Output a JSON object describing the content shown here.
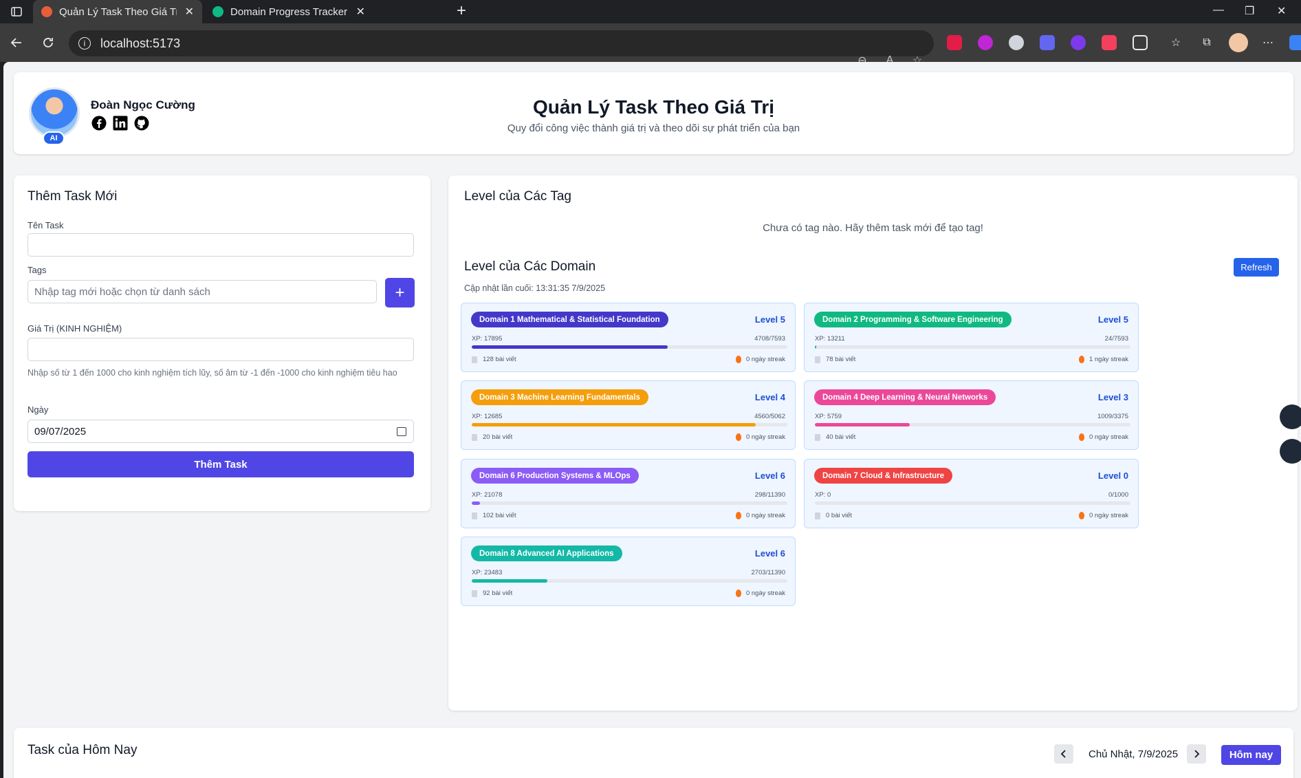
{
  "browser": {
    "tabs": [
      {
        "title": "Quản Lý Task Theo Giá Trị",
        "active": true
      },
      {
        "title": "Domain Progress Tracker API - Sw",
        "active": false
      }
    ],
    "url": "localhost:5173"
  },
  "header": {
    "user_name": "Đoàn Ngọc Cường",
    "avatar_badge": "AI",
    "title": "Quản Lý Task Theo Giá Trị",
    "subtitle": "Quy đổi công việc thành giá trị và theo dõi sự phát triển của bạn"
  },
  "form": {
    "title": "Thêm Task Mới",
    "task_name_label": "Tên Task",
    "task_name_value": "",
    "tags_label": "Tags",
    "tags_placeholder": "Nhập tag mới hoặc chọn từ danh sách",
    "add_tag_label": "+",
    "value_label": "Giá Trị (KINH NGHIỆM)",
    "value_value": "",
    "value_hint": "Nhập số từ 1 đến 1000 cho kinh nghiệm tích lũy, số âm từ -1 đến -1000 cho kinh nghiệm tiêu hao",
    "date_label": "Ngày",
    "date_value": "09/07/2025",
    "submit_label": "Thêm Task"
  },
  "levels": {
    "tags_title": "Level của Các Tag",
    "tags_empty": "Chưa có tag nào. Hãy thêm task mới để tạo tag!",
    "domains_title": "Level của Các Domain",
    "refresh_label": "Refresh",
    "last_updated": "Cập nhật lần cuối: 13:31:35 7/9/2025",
    "domains": [
      {
        "name": "Domain 1 Mathematical & Statistical Foundation",
        "level": "Level 5",
        "xp": "XP: 17895",
        "progress": "4708/7593",
        "fraction": 0.62,
        "posts": "128 bài viết",
        "streak": "0 ngày streak",
        "color": "#4338ca"
      },
      {
        "name": "Domain 2 Programming & Software Engineering",
        "level": "Level 5",
        "xp": "XP: 13211",
        "progress": "24/7593",
        "fraction": 0.003,
        "posts": "78 bài viết",
        "streak": "1 ngày streak",
        "color": "#10b981"
      },
      {
        "name": "Domain 3 Machine Learning Fundamentals",
        "level": "Level 4",
        "xp": "XP: 12685",
        "progress": "4560/5062",
        "fraction": 0.9,
        "posts": "20 bài viết",
        "streak": "0 ngày streak",
        "color": "#f59e0b"
      },
      {
        "name": "Domain 4 Deep Learning & Neural Networks",
        "level": "Level 3",
        "xp": "XP: 5759",
        "progress": "1009/3375",
        "fraction": 0.3,
        "posts": "40 bài viết",
        "streak": "0 ngày streak",
        "color": "#ec4899"
      },
      {
        "name": "Domain 6 Production Systems & MLOps",
        "level": "Level 6",
        "xp": "XP: 21078",
        "progress": "298/11390",
        "fraction": 0.026,
        "posts": "102 bài viết",
        "streak": "0 ngày streak",
        "color": "#8b5cf6"
      },
      {
        "name": "Domain 7 Cloud & Infrastructure",
        "level": "Level 0",
        "xp": "XP: 0",
        "progress": "0/1000",
        "fraction": 0,
        "posts": "0 bài viết",
        "streak": "0 ngày streak",
        "color": "#ef4444"
      },
      {
        "name": "Domain 8 Advanced AI Applications",
        "level": "Level 6",
        "xp": "XP: 23483",
        "progress": "2703/11390",
        "fraction": 0.24,
        "posts": "92 bài viết",
        "streak": "0 ngày streak",
        "color": "#14b8a6"
      }
    ]
  },
  "today": {
    "title": "Task của Hôm Nay",
    "date_text": "Chủ Nhật, 7/9/2025",
    "today_label": "Hôm nay"
  }
}
